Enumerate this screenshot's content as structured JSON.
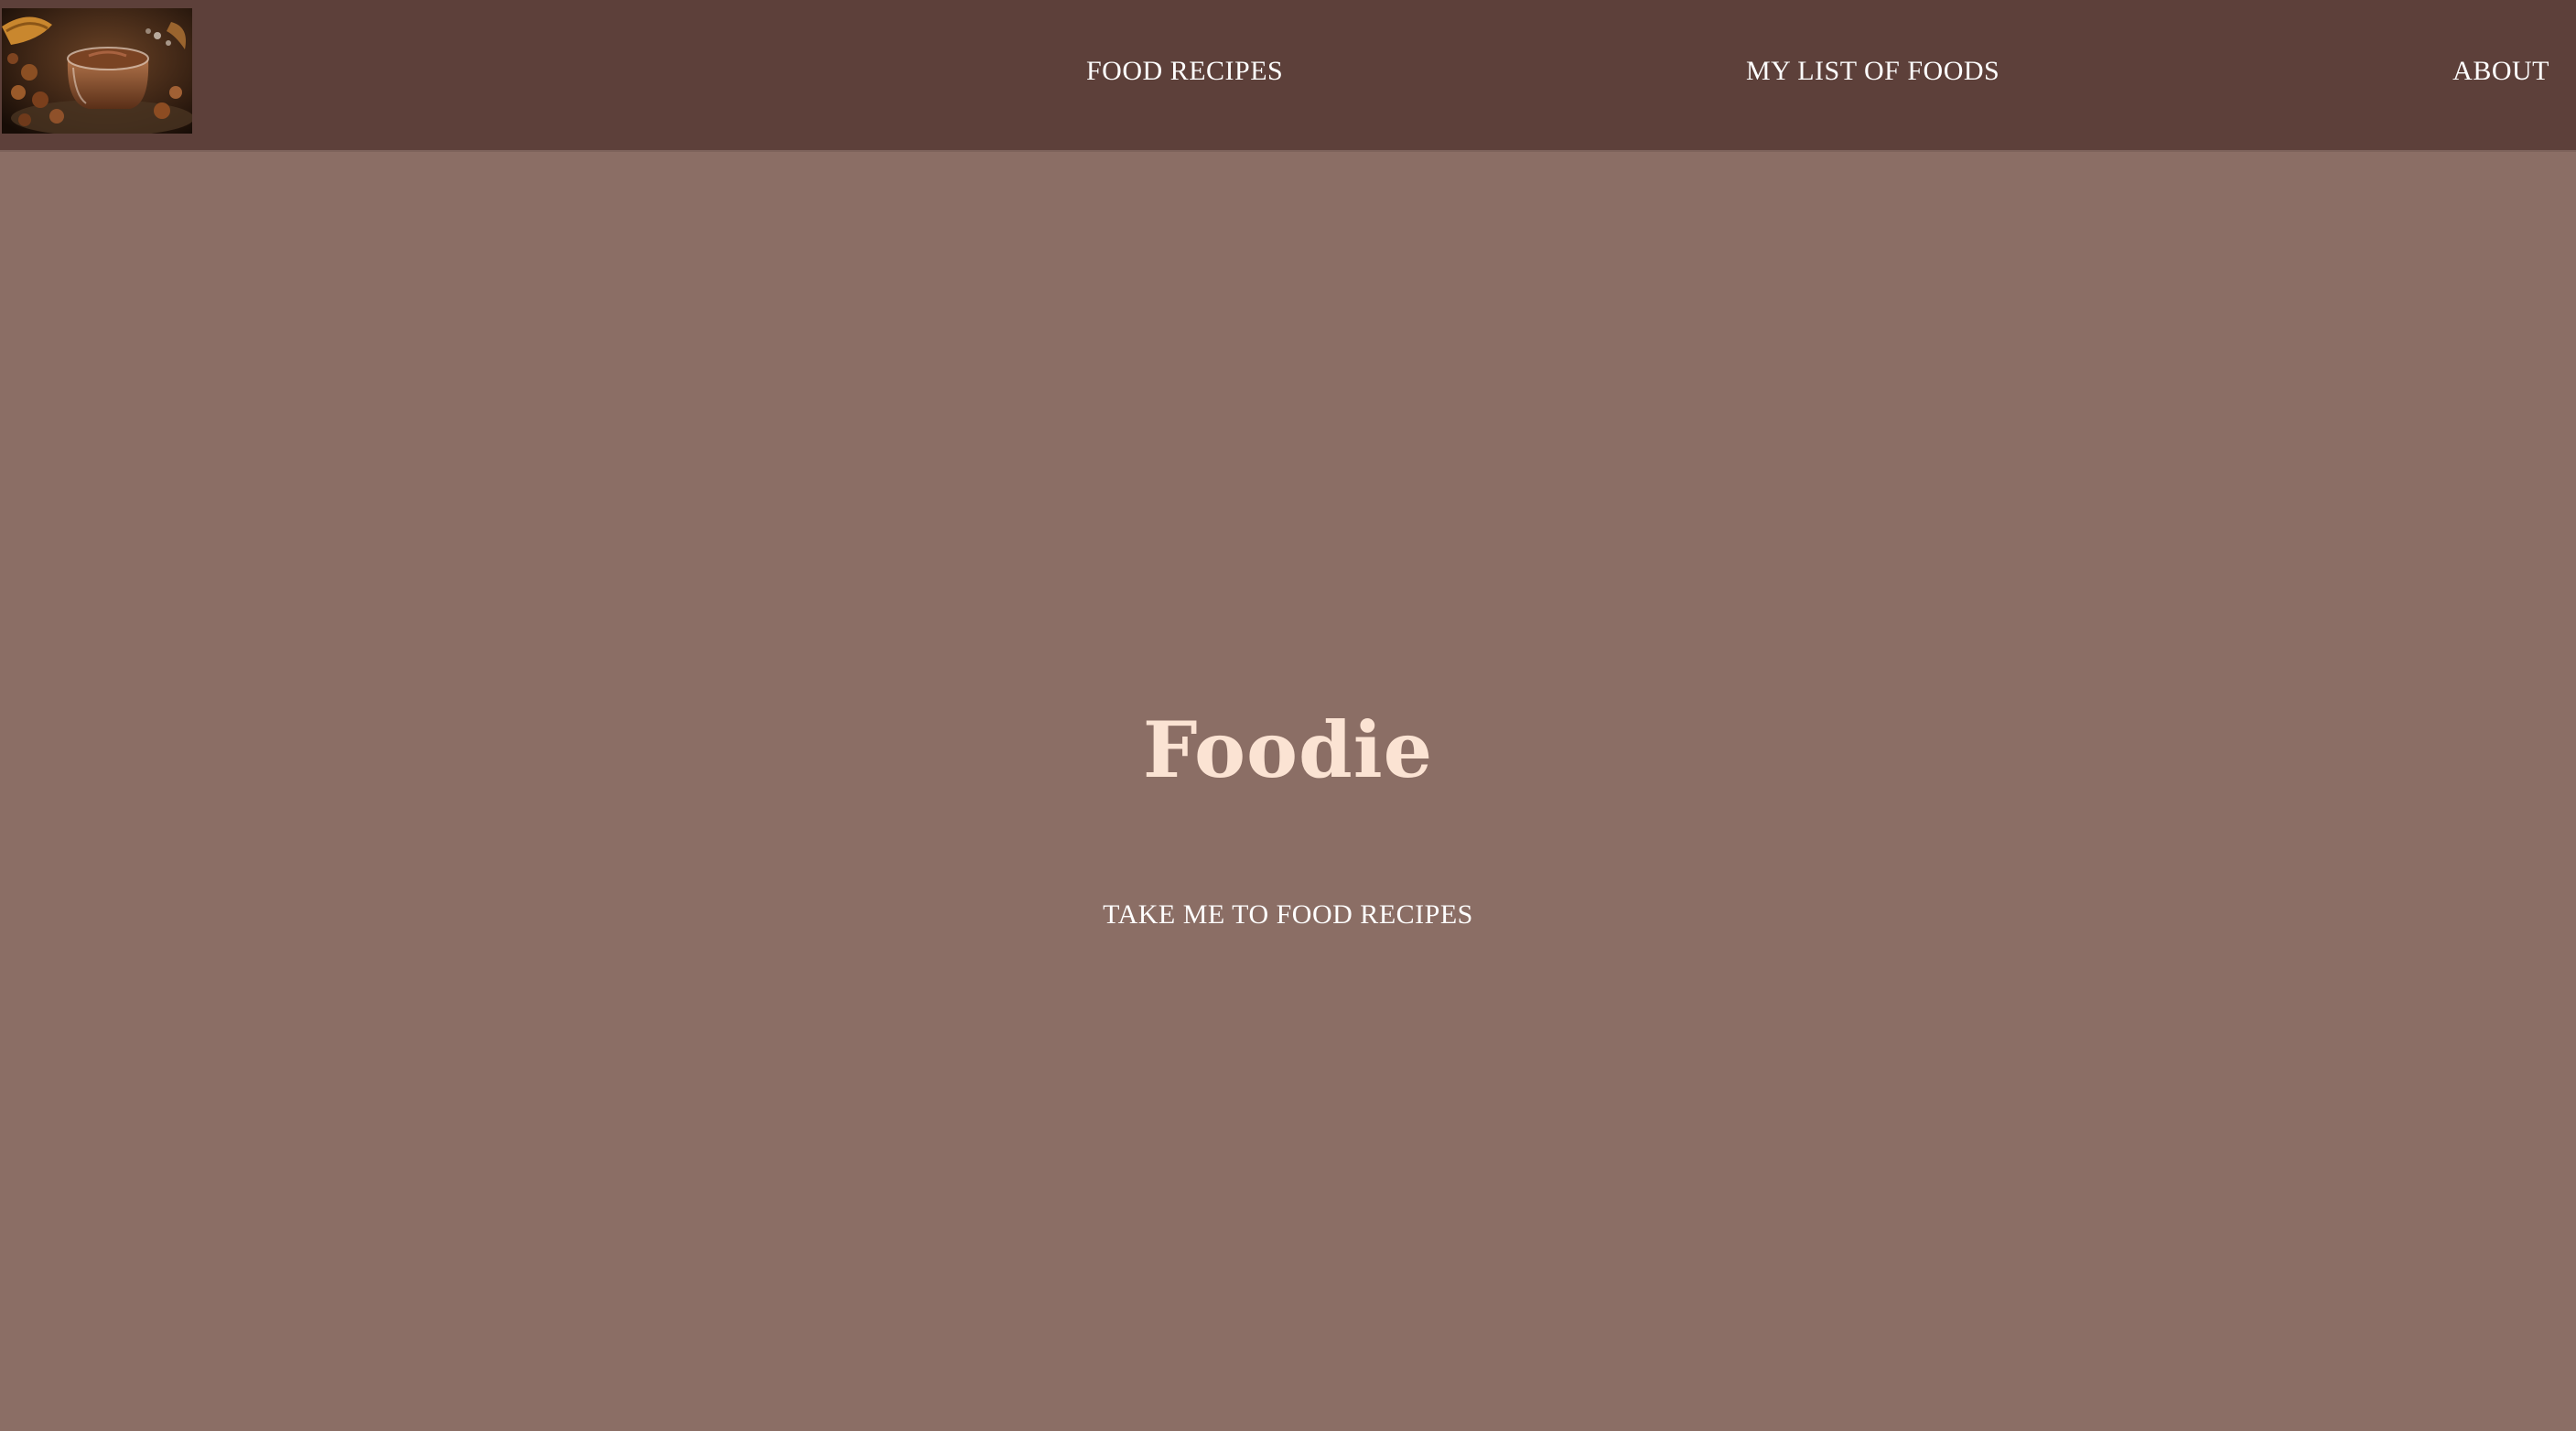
{
  "nav": {
    "links": [
      {
        "label": "FOOD RECIPES"
      },
      {
        "label": "MY LIST OF FOODS"
      },
      {
        "label": "ABOUT"
      }
    ]
  },
  "hero": {
    "title": "Foodie",
    "cta_label": "TAKE ME TO FOOD RECIPES"
  },
  "colors": {
    "navbar_bg": "#5d403a",
    "page_bg": "#8b6e65",
    "title_color": "#fbe3d3",
    "link_color": "#ffffff"
  },
  "icons": {
    "logo": "chocolate-spread-jar-photo"
  }
}
